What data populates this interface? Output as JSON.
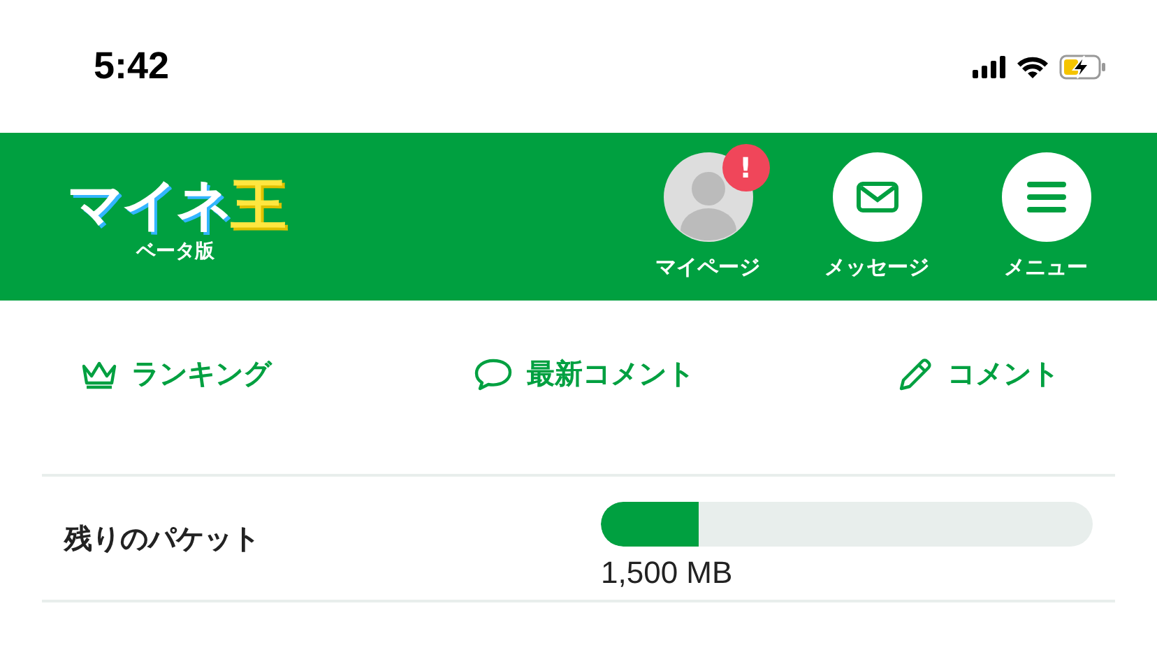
{
  "status_bar": {
    "time": "5:42"
  },
  "header": {
    "logo": "マイネ王",
    "logo_sub": "ベータ版",
    "actions": [
      {
        "kind": "avatar",
        "label": "マイページ",
        "badge": "!"
      },
      {
        "kind": "mail",
        "label": "メッセージ"
      },
      {
        "kind": "menu",
        "label": "メニュー"
      }
    ]
  },
  "nav": [
    {
      "kind": "crown",
      "label": "ランキング"
    },
    {
      "kind": "speech",
      "label": "最新コメント"
    },
    {
      "kind": "pencil",
      "label": "コメント"
    }
  ],
  "packet": {
    "label": "残りのパケット",
    "level": 0.2,
    "reading": "1,500 MB"
  }
}
